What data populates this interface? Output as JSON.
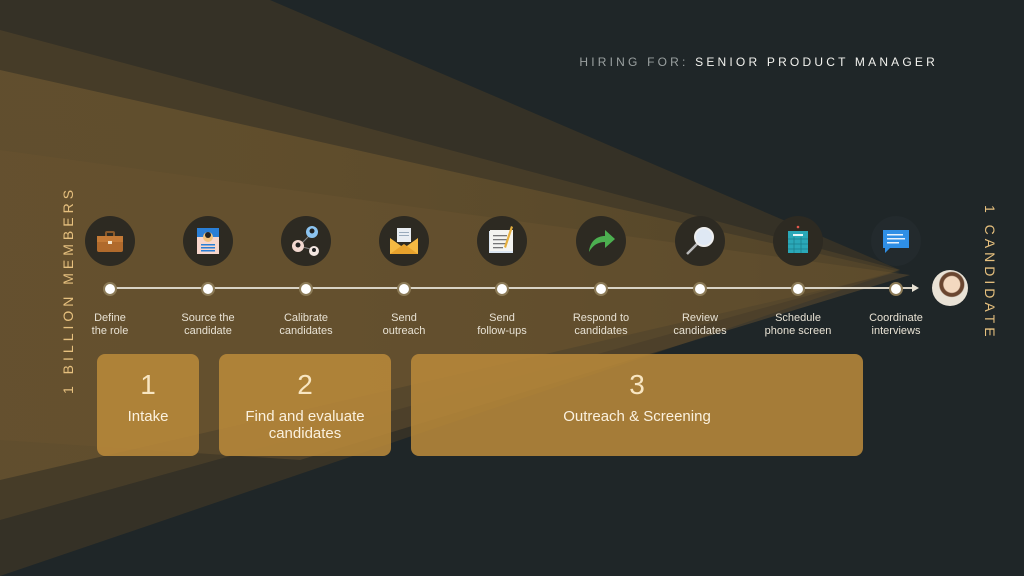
{
  "header": {
    "label": "HIRING FOR:",
    "value": "SENIOR PRODUCT MANAGER"
  },
  "funnel": {
    "start_label": "1 BILLION MEMBERS",
    "end_label": "1 CANDIDATE"
  },
  "steps": [
    {
      "label": "Define\nthe role",
      "icon": "briefcase-icon"
    },
    {
      "label": "Source the\ncandidate",
      "icon": "profile-card-icon"
    },
    {
      "label": "Calibrate\ncandidates",
      "icon": "people-network-icon"
    },
    {
      "label": "Send\noutreach",
      "icon": "envelope-icon"
    },
    {
      "label": "Send\nfollow-ups",
      "icon": "notepad-pencil-icon"
    },
    {
      "label": "Respond to\ncandidates",
      "icon": "reply-arrow-icon"
    },
    {
      "label": "Review\ncandidates",
      "icon": "magnifier-icon"
    },
    {
      "label": "Schedule\nphone screen",
      "icon": "calendar-icon"
    },
    {
      "label": "Coordinate\ninterviews",
      "icon": "chat-bubble-icon"
    }
  ],
  "phases": [
    {
      "number": "1",
      "name": "Intake"
    },
    {
      "number": "2",
      "name": "Find and evaluate candidates"
    },
    {
      "number": "3",
      "name": "Outreach & Screening"
    }
  ],
  "colors": {
    "background": "#1f2628",
    "accent_gold": "#b8893a",
    "label_gold": "#e6c07e"
  }
}
